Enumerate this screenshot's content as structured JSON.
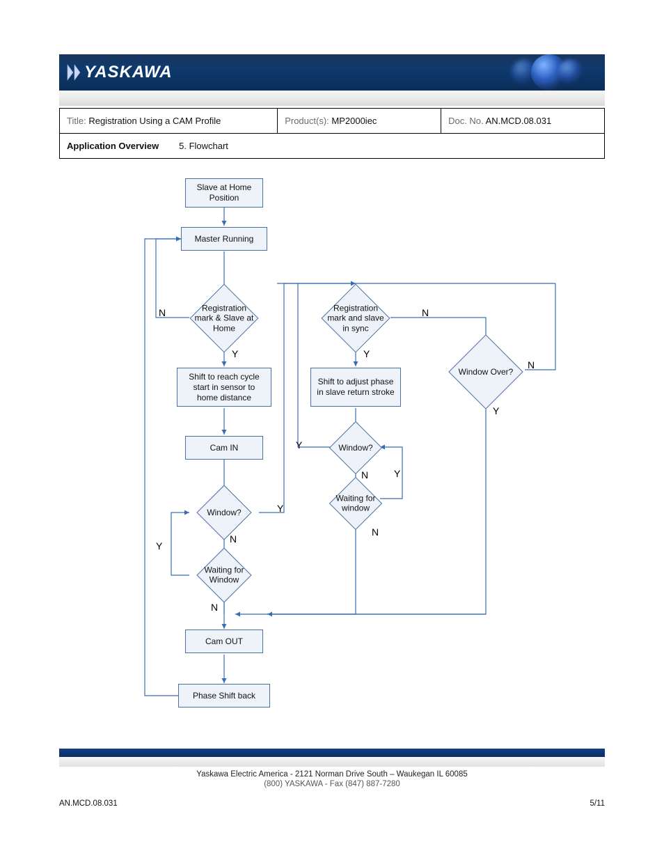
{
  "brand": "YASKAWA",
  "meta": {
    "title_label": "Title:",
    "title_value": "Registration Using a CAM Profile",
    "product_label": "Product(s):",
    "product_value": "MP2000iec",
    "docno_label": "Doc. No.",
    "docno_value": "AN.MCD.08.031",
    "subject_label": "Application Overview",
    "section_value": "5. Flowchart"
  },
  "flow": {
    "slave_home": "Slave at Home Position",
    "master_running": "Master Running",
    "reg_home": "Registration mark & Slave at Home",
    "shift_reach": "Shift to reach cycle start in sensor to home distance",
    "cam_in": "Cam IN",
    "window_q1": "Window?",
    "wait_window1": "Waiting for Window",
    "cam_out": "Cam OUT",
    "phase_back": "Phase Shift back",
    "reg_sync": "Registration mark and slave in sync",
    "shift_adjust": "Shift to adjust phase in slave return stroke",
    "window_q2": "Window?",
    "wait_window2": "Waiting for window",
    "window_over": "Window Over?"
  },
  "yn": {
    "Y": "Y",
    "N": "N"
  },
  "footer": {
    "addr": "Yaskawa Electric America - 2121 Norman Drive South – Waukegan IL 60085",
    "contact": "(800) YASKAWA - Fax (847) 887-7280",
    "doc_bottom": "AN.MCD.08.031",
    "page": "5/11"
  }
}
